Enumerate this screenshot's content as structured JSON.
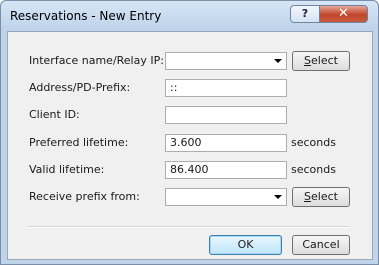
{
  "window": {
    "title": "Reservations - New Entry",
    "help_label": "?",
    "close_label": "✕"
  },
  "form": {
    "interface": {
      "label": "Interface name/Relay IP:",
      "value": "",
      "button_accel": "S",
      "button_rest": "elect"
    },
    "address": {
      "label": "Address/PD-Prefix:",
      "value": "::"
    },
    "client_id": {
      "label": "Client ID:",
      "value": ""
    },
    "preferred": {
      "label": "Preferred lifetime:",
      "value": "3.600",
      "unit": "seconds"
    },
    "valid": {
      "label": "Valid lifetime:",
      "value": "86.400",
      "unit": "seconds"
    },
    "prefix_from": {
      "label": "Receive prefix from:",
      "value": "",
      "button_accel": "S",
      "button_rest": "elect"
    }
  },
  "footer": {
    "ok_label": "OK",
    "cancel_label": "Cancel"
  }
}
